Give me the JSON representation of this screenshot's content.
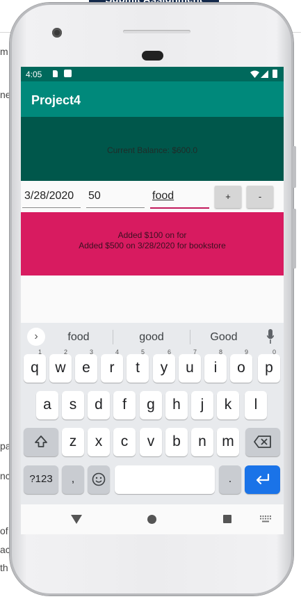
{
  "background": {
    "banner_text": "Submit Assignment",
    "fragments": [
      "m",
      "ne",
      "pa",
      "nc",
      "of",
      "ac",
      "th"
    ]
  },
  "status_bar": {
    "time": "4:05"
  },
  "app": {
    "title": "Project4"
  },
  "balance": {
    "text": "Current Balance: $600.0"
  },
  "inputs": {
    "date": "3/28/2020",
    "amount": "50",
    "category": "food"
  },
  "buttons": {
    "add": "+",
    "subtract": "-"
  },
  "log": [
    "Added $100 on  for",
    "Added $500 on 3/28/2020 for bookstore"
  ],
  "keyboard": {
    "suggestions": [
      "food",
      "good",
      "Good"
    ],
    "row1": [
      {
        "k": "q",
        "n": "1"
      },
      {
        "k": "w",
        "n": "2"
      },
      {
        "k": "e",
        "n": "3"
      },
      {
        "k": "r",
        "n": "4"
      },
      {
        "k": "t",
        "n": "5"
      },
      {
        "k": "y",
        "n": "6"
      },
      {
        "k": "u",
        "n": "7"
      },
      {
        "k": "i",
        "n": "8"
      },
      {
        "k": "o",
        "n": "9"
      },
      {
        "k": "p",
        "n": "0"
      }
    ],
    "row2": [
      "a",
      "s",
      "d",
      "f",
      "g",
      "h",
      "j",
      "k",
      "l"
    ],
    "row3": [
      "z",
      "x",
      "c",
      "v",
      "b",
      "n",
      "m"
    ],
    "symbols_label": "?123",
    "comma_label": ",",
    "period_label": "."
  },
  "colors": {
    "status_bar": "#00695c",
    "app_bar": "#00897b",
    "balance_panel": "#00574b",
    "log_panel": "#d81b60",
    "accent_underline": "#c2185b",
    "enter_key": "#1a73e8"
  },
  "icons": [
    "camera-icon",
    "sim-icon",
    "app-notification-icon",
    "wifi-icon",
    "cell-signal-icon",
    "battery-icon",
    "chevron-right-icon",
    "mic-icon",
    "shift-icon",
    "backspace-icon",
    "emoji-icon",
    "enter-icon",
    "back-icon",
    "home-icon",
    "recents-icon",
    "keyboard-icon"
  ]
}
